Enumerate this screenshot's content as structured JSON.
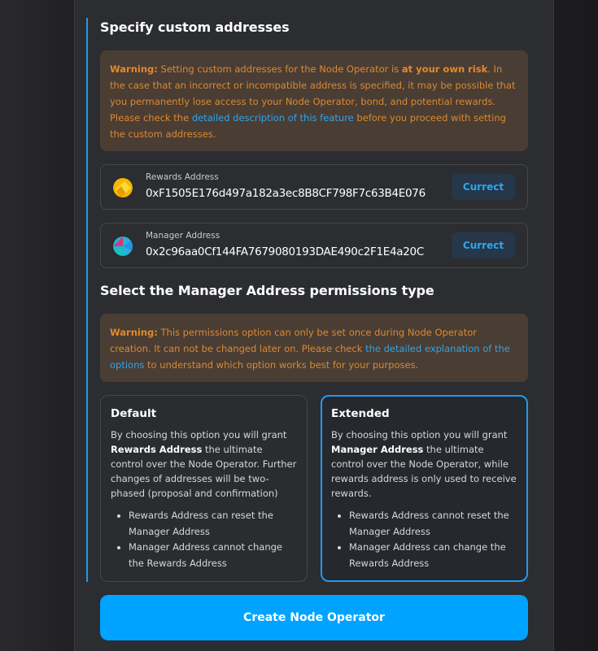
{
  "custom_addresses": {
    "heading": "Specify custom addresses",
    "warning": {
      "label": "Warning:",
      "text_1": " Setting custom addresses for the Node Operator is ",
      "bold": "at your own risk",
      "text_2": ". In the case that an incorrect or incompatible address is specified, it may be possible that you permanently lose access to your Node Operator, bond, and potential rewards. Please check the ",
      "link": "detailed description of this feature",
      "text_3": " before you proceed with setting the custom addresses."
    },
    "rewards": {
      "label": "Rewards Address",
      "value": "0xF1505E176d497a182a3ec8B8CF798F7c63B4E076",
      "button": "Currect"
    },
    "manager": {
      "label": "Manager Address",
      "value": "0x2c96aa0Cf144FA7679080193DAE490c2F1E4a20C",
      "button": "Currect"
    }
  },
  "permissions": {
    "heading": "Select the Manager Address permissions type",
    "warning": {
      "label": "Warning:",
      "text_1": " This permissions option can only be set once during Node Operator creation. It can not be changed later on. Please check ",
      "link": "the detailed explanation of the options",
      "text_2": " to understand which option works best for your purposes."
    },
    "default": {
      "title": "Default",
      "desc_1": "By choosing this option you will grant ",
      "desc_bold": "Rewards Address",
      "desc_2": " the ultimate control over the Node Operator. Further changes of addresses will be two-phased (proposal and confirmation)",
      "bullets": [
        "Rewards Address can reset the Manager Address",
        "Manager Address cannot change the Rewards Address"
      ]
    },
    "extended": {
      "title": "Extended",
      "desc_1": "By choosing this option you will grant ",
      "desc_bold": "Manager Address",
      "desc_2": " the ultimate control over the Node Operator, while rewards address is only used to receive rewards.",
      "bullets": [
        "Rewards Address cannot reset the Manager Address",
        "Manager Address can change the Rewards Address"
      ],
      "selected": true
    }
  },
  "create_button": "Create Node Operator",
  "colors": {
    "accent": "#00a3ff",
    "warning_text": "#d98a34",
    "warning_bg": "#4a3d33"
  }
}
